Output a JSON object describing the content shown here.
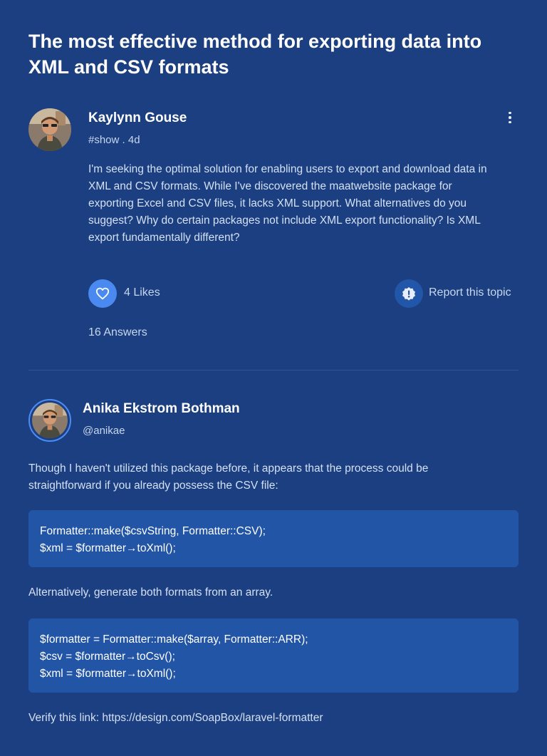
{
  "topic": {
    "title": "The most effective method for exporting data into XML and CSV formats",
    "author": {
      "name": "Kaylynn Gouse",
      "meta": "#show . 4d",
      "avatar_icon": "user-avatar"
    },
    "body": "I'm seeking the optimal solution for enabling users to export and download data in XML and CSV formats. While I've discovered the maatwebsite package for exporting Excel and CSV files, it lacks XML support. What alternatives do you suggest? Why do certain packages not include XML export functionality? Is XML export fundamentally different?",
    "likes_label": "4 Likes",
    "report_label": "Report this topic",
    "answers_label": "16 Answers",
    "icons": {
      "more": "more-vertical-icon",
      "like": "heart-icon",
      "report": "alert-icon"
    }
  },
  "answer": {
    "author": {
      "name": "Anika Ekstrom Bothman",
      "handle": "@anikae",
      "avatar_icon": "user-avatar"
    },
    "intro": "Though I haven't utilized this package before, it appears that the process could be straightforward if you already possess the CSV file:",
    "code1": [
      "Formatter::make($csvString, Formatter::CSV);",
      "$xml = $formatter→toXml();"
    ],
    "middle": "Alternatively, generate both formats from an array.",
    "code2": [
      "$formatter = Formatter::make($array, Formatter::ARR);",
      "$csv = $formatter→toCsv();",
      "$xml = $formatter→toXml();"
    ],
    "footer": "Verify this link: https://design.com/SoapBox/laravel-formatter"
  },
  "colors": {
    "background": "#1b3f80",
    "accent": "#4a8af0",
    "code_background": "#2255a5"
  }
}
